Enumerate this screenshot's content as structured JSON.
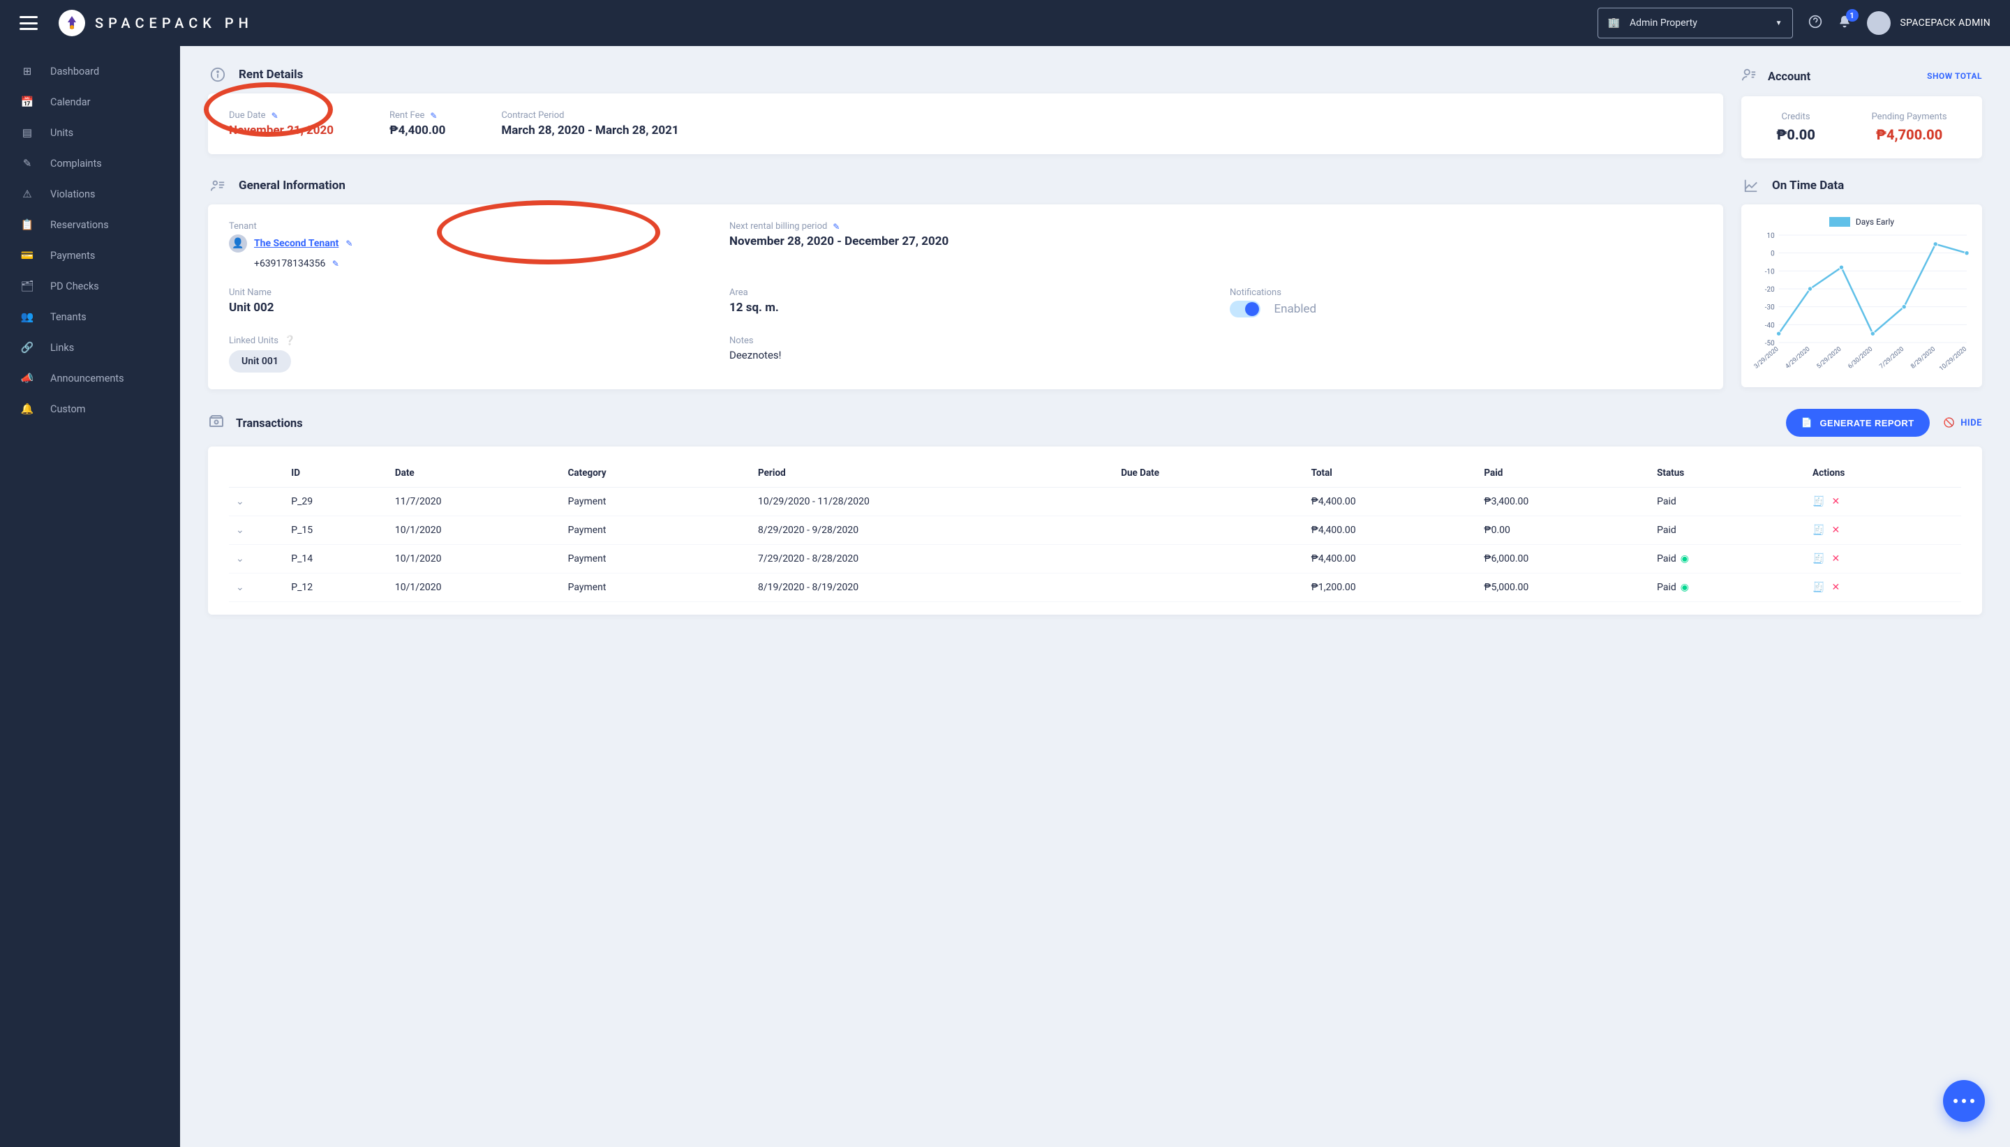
{
  "brand": "SPACEPACK PH",
  "topbar": {
    "property_selected": "Admin Property",
    "notif_count": "1",
    "user_name": "SPACEPACK ADMIN"
  },
  "sidebar": {
    "items": [
      {
        "icon": "⊞",
        "label": "Dashboard"
      },
      {
        "icon": "📅",
        "label": "Calendar"
      },
      {
        "icon": "▤",
        "label": "Units"
      },
      {
        "icon": "✎",
        "label": "Complaints"
      },
      {
        "icon": "⚠",
        "label": "Violations"
      },
      {
        "icon": "📋",
        "label": "Reservations"
      },
      {
        "icon": "💳",
        "label": "Payments"
      },
      {
        "icon": "🗂",
        "label": "PD Checks"
      },
      {
        "icon": "👥",
        "label": "Tenants"
      },
      {
        "icon": "🔗",
        "label": "Links"
      },
      {
        "icon": "📣",
        "label": "Announcements"
      },
      {
        "icon": "🔔",
        "label": "Custom"
      }
    ]
  },
  "rent": {
    "title": "Rent Details",
    "due_date_label": "Due Date",
    "due_date": "November 21, 2020",
    "rent_fee_label": "Rent Fee",
    "rent_fee": "₱4,400.00",
    "contract_label": "Contract Period",
    "contract": "March 28, 2020 - March 28, 2021"
  },
  "account": {
    "title": "Account",
    "show_total": "SHOW TOTAL",
    "credits_label": "Credits",
    "credits": "₱0.00",
    "pending_label": "Pending Payments",
    "pending": "₱4,700.00"
  },
  "general": {
    "title": "General Information",
    "tenant_label": "Tenant",
    "tenant_name": "The Second Tenant",
    "tenant_phone": "+639178134356",
    "next_period_label": "Next rental billing period",
    "next_period": "November 28, 2020 - December 27, 2020",
    "unit_name_label": "Unit Name",
    "unit_name": "Unit 002",
    "area_label": "Area",
    "area": "12 sq. m.",
    "notif_label": "Notifications",
    "notif_value": "Enabled",
    "linked_label": "Linked Units",
    "linked_unit": "Unit 001",
    "notes_label": "Notes",
    "notes": "Deeznotes!"
  },
  "ontime": {
    "title": "On Time Data",
    "legend": "Days Early"
  },
  "chart_data": {
    "type": "line",
    "title": "On Time Data",
    "ylabel": "Days Early",
    "xlabel": "",
    "ylim": [
      -50,
      10
    ],
    "categories": [
      "3/29/2020",
      "4/29/2020",
      "5/29/2020",
      "6/30/2020",
      "7/29/2020",
      "8/29/2020",
      "10/29/2020"
    ],
    "series": [
      {
        "name": "Days Early",
        "values": [
          -45,
          -20,
          -8,
          -45,
          -30,
          5,
          0
        ]
      }
    ]
  },
  "transactions": {
    "title": "Transactions",
    "generate": "GENERATE REPORT",
    "hide": "HIDE",
    "headers": {
      "id": "ID",
      "date": "Date",
      "category": "Category",
      "period": "Period",
      "due": "Due Date",
      "total": "Total",
      "paid": "Paid",
      "status": "Status",
      "actions": "Actions"
    },
    "rows": [
      {
        "id": "P_29",
        "date": "11/7/2020",
        "category": "Payment",
        "period": "10/29/2020 - 11/28/2020",
        "due": "",
        "total": "₱4,400.00",
        "paid": "₱3,400.00",
        "status": "Paid",
        "status_ok": false
      },
      {
        "id": "P_15",
        "date": "10/1/2020",
        "category": "Payment",
        "period": "8/29/2020 - 9/28/2020",
        "due": "",
        "total": "₱4,400.00",
        "paid": "₱0.00",
        "status": "Paid",
        "status_ok": false
      },
      {
        "id": "P_14",
        "date": "10/1/2020",
        "category": "Payment",
        "period": "7/29/2020 - 8/28/2020",
        "due": "",
        "total": "₱4,400.00",
        "paid": "₱6,000.00",
        "status": "Paid",
        "status_ok": true
      },
      {
        "id": "P_12",
        "date": "10/1/2020",
        "category": "Payment",
        "period": "8/19/2020 - 8/19/2020",
        "due": "",
        "total": "₱1,200.00",
        "paid": "₱5,000.00",
        "status": "Paid",
        "status_ok": true
      }
    ]
  }
}
